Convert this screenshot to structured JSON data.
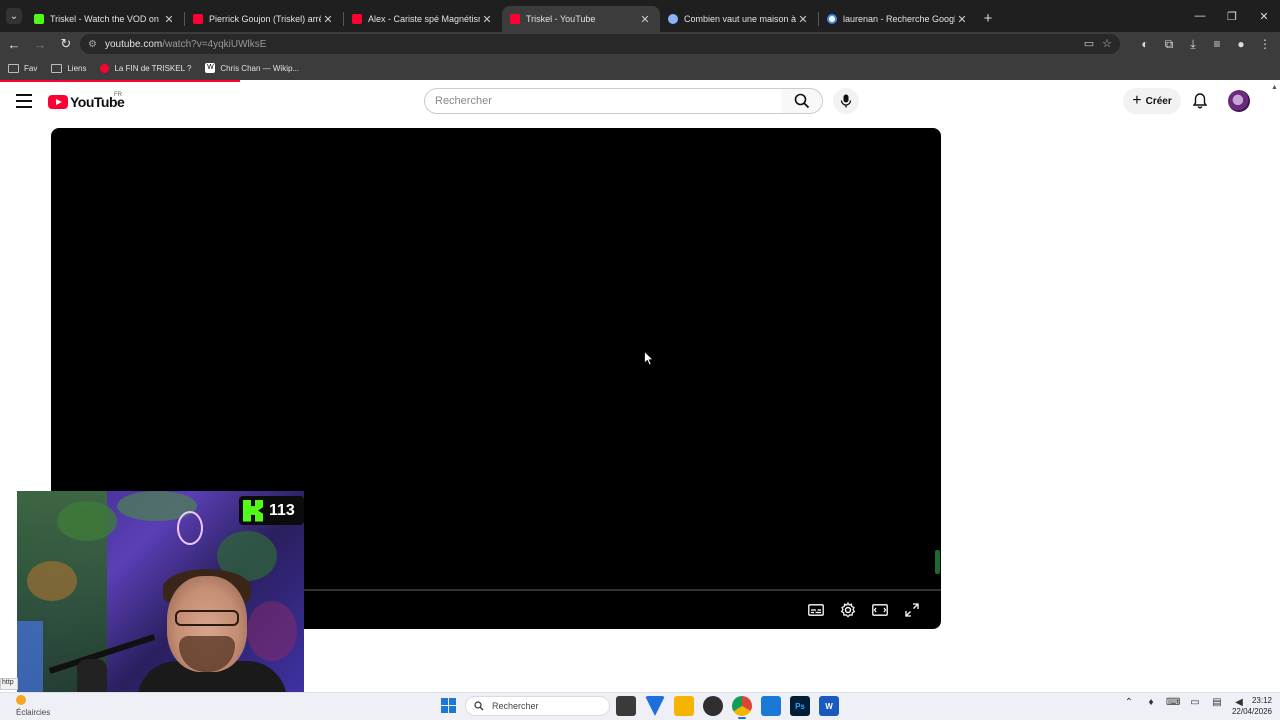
{
  "browser": {
    "tabs": [
      {
        "label": "Triskel - Watch the VOD on Kick",
        "favicon_color": "#53fc18",
        "active": false
      },
      {
        "label": "Pierrick Goujon (Triskel) arrête l",
        "favicon_color": "#ff0033",
        "active": false
      },
      {
        "label": "Alex - Cariste spé Magnétisme",
        "favicon_color": "#ff0033",
        "active": false
      },
      {
        "label": "Triskel - YouTube",
        "favicon_color": "#ff0033",
        "active": true
      },
      {
        "label": "Combien vaut une maison à La",
        "favicon_color": "#8ab4f8",
        "active": false
      },
      {
        "label": "laurenan - Recherche Google",
        "favicon_color": "#4285f4",
        "active": false
      }
    ],
    "close_glyph": "✕",
    "new_tab_glyph": "+",
    "url_domain": "youtube.com",
    "url_path": "/watch?v=4yqkiUWlksE",
    "bookmarks": [
      {
        "label": "Fav",
        "icon": "folder-icon"
      },
      {
        "label": "Liens",
        "icon": "folder-icon"
      },
      {
        "label": "La FIN de TRISKEL ?",
        "icon": "youtube-icon"
      },
      {
        "label": "Chris Chan — Wikip...",
        "icon": "wikipedia-icon"
      }
    ],
    "status_tooltip": "http"
  },
  "youtube": {
    "logo_text": "YouTube",
    "country_code": "FR",
    "search_placeholder": "Rechercher",
    "create_label": "Créer",
    "create_plus": "+"
  },
  "overlay": {
    "kick_viewers": "113"
  },
  "taskbar": {
    "weather_label": "Éclaircies",
    "search_placeholder": "Rechercher",
    "apps": [
      {
        "name": "task-view",
        "color": "#3a3a3a",
        "text": ""
      },
      {
        "name": "vpn",
        "color": "#1e6fd9",
        "text": ""
      },
      {
        "name": "file-explorer",
        "color": "#f4b400",
        "text": ""
      },
      {
        "name": "obs",
        "color": "#302e31",
        "text": ""
      },
      {
        "name": "chrome",
        "color": "#4285f4",
        "text": ""
      },
      {
        "name": "kick-app",
        "color": "#1a78d6",
        "text": ""
      },
      {
        "name": "photoshop",
        "color": "#001e36",
        "text": "Ps"
      },
      {
        "name": "word",
        "color": "#185abd",
        "text": "W"
      }
    ],
    "time": "23:12",
    "date": "22/04/2026"
  }
}
